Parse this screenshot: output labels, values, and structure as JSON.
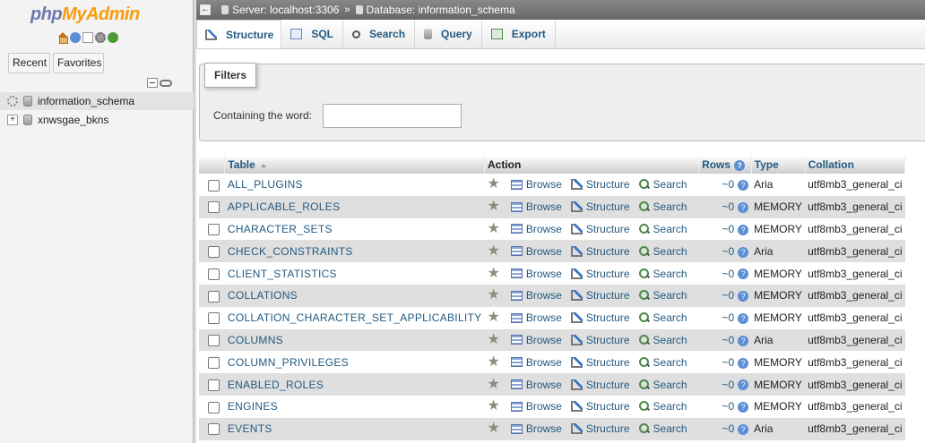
{
  "nav": {
    "logo_php": "php",
    "logo_myadmin": "MyAdmin",
    "icons": [
      "home-icon",
      "help-icon",
      "docs-icon",
      "settings-icon",
      "reload-icon"
    ],
    "recent_label": "Recent",
    "favorites_label": "Favorites",
    "databases": [
      "information_schema",
      "xnwsgae_bkns"
    ]
  },
  "breadcrumb": {
    "server": "Server: localhost:3306",
    "separator": "»",
    "database": "Database: information_schema"
  },
  "tabs": [
    "Structure",
    "SQL",
    "Search",
    "Query",
    "Export"
  ],
  "filters": {
    "legend": "Filters",
    "label": "Containing the word:",
    "value": ""
  },
  "table": {
    "headers": {
      "table": "Table",
      "action": "Action",
      "rows": "Rows",
      "type": "Type",
      "collation": "Collation"
    },
    "action_labels": {
      "browse": "Browse",
      "structure": "Structure",
      "search": "Search"
    },
    "rows": [
      {
        "name": "ALL_PLUGINS",
        "rows": "~0",
        "type": "Aria",
        "collation": "utf8mb3_general_ci"
      },
      {
        "name": "APPLICABLE_ROLES",
        "rows": "~0",
        "type": "MEMORY",
        "collation": "utf8mb3_general_ci"
      },
      {
        "name": "CHARACTER_SETS",
        "rows": "~0",
        "type": "MEMORY",
        "collation": "utf8mb3_general_ci"
      },
      {
        "name": "CHECK_CONSTRAINTS",
        "rows": "~0",
        "type": "Aria",
        "collation": "utf8mb3_general_ci"
      },
      {
        "name": "CLIENT_STATISTICS",
        "rows": "~0",
        "type": "MEMORY",
        "collation": "utf8mb3_general_ci"
      },
      {
        "name": "COLLATIONS",
        "rows": "~0",
        "type": "MEMORY",
        "collation": "utf8mb3_general_ci"
      },
      {
        "name": "COLLATION_CHARACTER_SET_APPLICABILITY",
        "rows": "~0",
        "type": "MEMORY",
        "collation": "utf8mb3_general_ci"
      },
      {
        "name": "COLUMNS",
        "rows": "~0",
        "type": "Aria",
        "collation": "utf8mb3_general_ci"
      },
      {
        "name": "COLUMN_PRIVILEGES",
        "rows": "~0",
        "type": "MEMORY",
        "collation": "utf8mb3_general_ci"
      },
      {
        "name": "ENABLED_ROLES",
        "rows": "~0",
        "type": "MEMORY",
        "collation": "utf8mb3_general_ci"
      },
      {
        "name": "ENGINES",
        "rows": "~0",
        "type": "MEMORY",
        "collation": "utf8mb3_general_ci"
      },
      {
        "name": "EVENTS",
        "rows": "~0",
        "type": "Aria",
        "collation": "utf8mb3_general_ci"
      }
    ]
  },
  "colors": {
    "link": "#235a81",
    "logo_php": "#6c78af",
    "logo_myadmin": "#f89c0e",
    "row_alt": "#dfdfdf"
  }
}
